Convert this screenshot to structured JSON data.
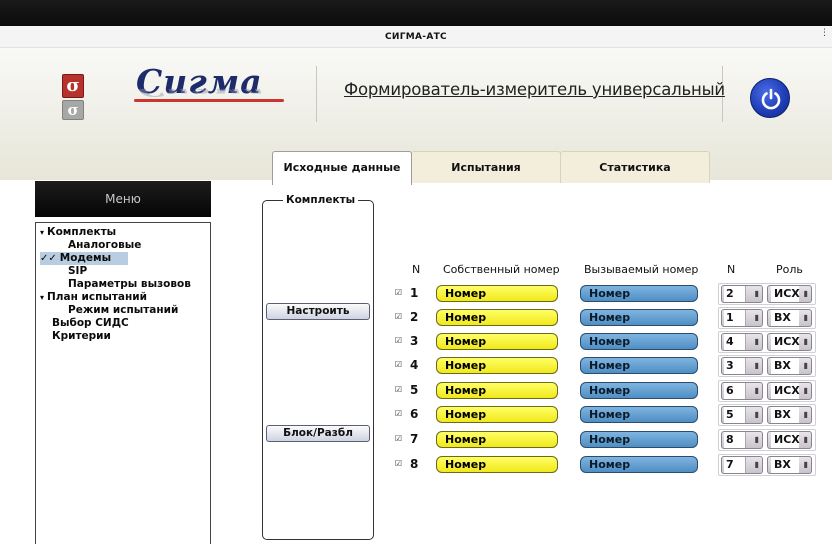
{
  "window": {
    "title": "СИГМА-АТС"
  },
  "header": {
    "logo_text": "Сигма",
    "logo_letter": "σ",
    "app_title": "Формирователь-измеритель универсальный"
  },
  "tabs": [
    {
      "label": "Исходные данные",
      "active": true
    },
    {
      "label": "Испытания",
      "active": false
    },
    {
      "label": "Статистика",
      "active": false
    }
  ],
  "menu": {
    "header": "Меню",
    "items": [
      {
        "label": "Комплекты",
        "prefix": "▾"
      },
      {
        "label": "Аналоговые",
        "prefix": ""
      },
      {
        "label": "Модемы",
        "prefix": "✓✓"
      },
      {
        "label": "SIP",
        "prefix": ""
      },
      {
        "label": "Параметры вызовов",
        "prefix": ""
      },
      {
        "label": "План испытаний",
        "prefix": "▾"
      },
      {
        "label": "Режим испытаний",
        "prefix": ""
      },
      {
        "label": "Выбор СИДС",
        "prefix": ""
      },
      {
        "label": "Критерии",
        "prefix": ""
      }
    ]
  },
  "kits": {
    "legend": "Комплекты",
    "configure_button": "Настроить",
    "block_button": "Блок/Разбл"
  },
  "table": {
    "headers": {
      "n": "N",
      "own_number": "Собственный номер",
      "called_number": "Вызываемый номер",
      "n2": "N",
      "role": "Роль"
    },
    "rows": [
      {
        "num": "1",
        "own": "Номер",
        "called": "Номер",
        "n": "2",
        "role": "ИСХ"
      },
      {
        "num": "2",
        "own": "Номер",
        "called": "Номер",
        "n": "1",
        "role": "ВХ"
      },
      {
        "num": "3",
        "own": "Номер",
        "called": "Номер",
        "n": "4",
        "role": "ИСХ"
      },
      {
        "num": "4",
        "own": "Номер",
        "called": "Номер",
        "n": "3",
        "role": "ВХ"
      },
      {
        "num": "5",
        "own": "Номер",
        "called": "Номер",
        "n": "6",
        "role": "ИСХ"
      },
      {
        "num": "6",
        "own": "Номер",
        "called": "Номер",
        "n": "5",
        "role": "ВХ"
      },
      {
        "num": "7",
        "own": "Номер",
        "called": "Номер",
        "n": "8",
        "role": "ИСХ"
      },
      {
        "num": "8",
        "own": "Номер",
        "called": "Номер",
        "n": "7",
        "role": "ВХ"
      }
    ]
  },
  "colors": {
    "own_field": "#f1e81c",
    "called_field": "#4f8ec3",
    "logo_blue": "#1d2b6b",
    "logo_red": "#b8322d",
    "power": "#1c3bb5"
  }
}
